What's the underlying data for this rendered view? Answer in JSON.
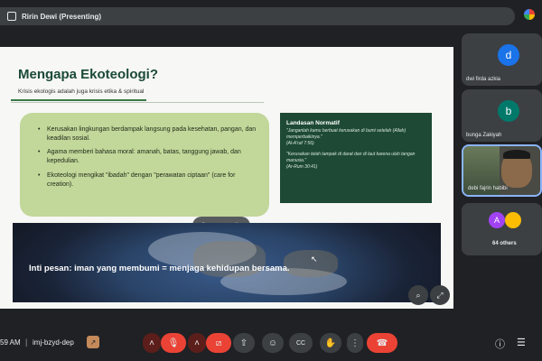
{
  "presenter_bar": {
    "label": "Ririn Dewi (Presenting)"
  },
  "slide": {
    "title": "Mengapa Ekoteologi?",
    "subtitle": "Krisis ekologis adalah juga krisis etika & spiritual",
    "bullets": [
      "Kerusakan lingkungan berdampak langsung pada kesehatan, pangan, dan keadilan sosial.",
      "Agama memberi bahasa moral: amanah, batas, tanggung jawab, dan kepedulian.",
      "Ekoteologi mengikat \"ibadah\" dengan \"perawatan ciptaan\" (care for creation)."
    ],
    "norm_box": {
      "title": "Landasan Normatif",
      "quote1": "\"Janganlah kamu berbuat kerusakan di bumi setelah (Allah) memperbaikinya.\"",
      "ref1": "(Al-A'raf 7:56)",
      "quote2": "\"Kerusakan telah tampak di darat dan di laut karena ulah tangan manusia.\"",
      "ref2": "(Ar-Rum 30:41)"
    },
    "banner_text": "Inti pesan: iman yang membumi = menjaga kehidupan bersama."
  },
  "participants": [
    {
      "name": "dwi firda azkia",
      "initial": "d",
      "color": "#1a73e8"
    },
    {
      "name": "bunga Zakiyah",
      "initial": "b",
      "color": "#00796b"
    },
    {
      "name": "debi fajrin habibi"
    }
  ],
  "others": {
    "label": "64 others",
    "initial": "A",
    "color": "#a142f4"
  },
  "bottom": {
    "time": "59 AM",
    "divider": "|",
    "meeting_code": "imj-bzyd-dep",
    "code_icon": "↗"
  },
  "icons": {
    "chevron_up": "˄",
    "mic_off": "🎙",
    "cam_off": "⧄",
    "present": "⇧",
    "emoji": "☺",
    "captions": "CC",
    "hand": "✋",
    "more": "⋮",
    "end_call": "☎",
    "info": "ⓘ",
    "chat": "☰",
    "zoom": "⌕",
    "expand": "⤢",
    "overlay_1": "✀",
    "overlay_2": "⊘",
    "overlay_3": "⋮",
    "cursor": "↖"
  }
}
